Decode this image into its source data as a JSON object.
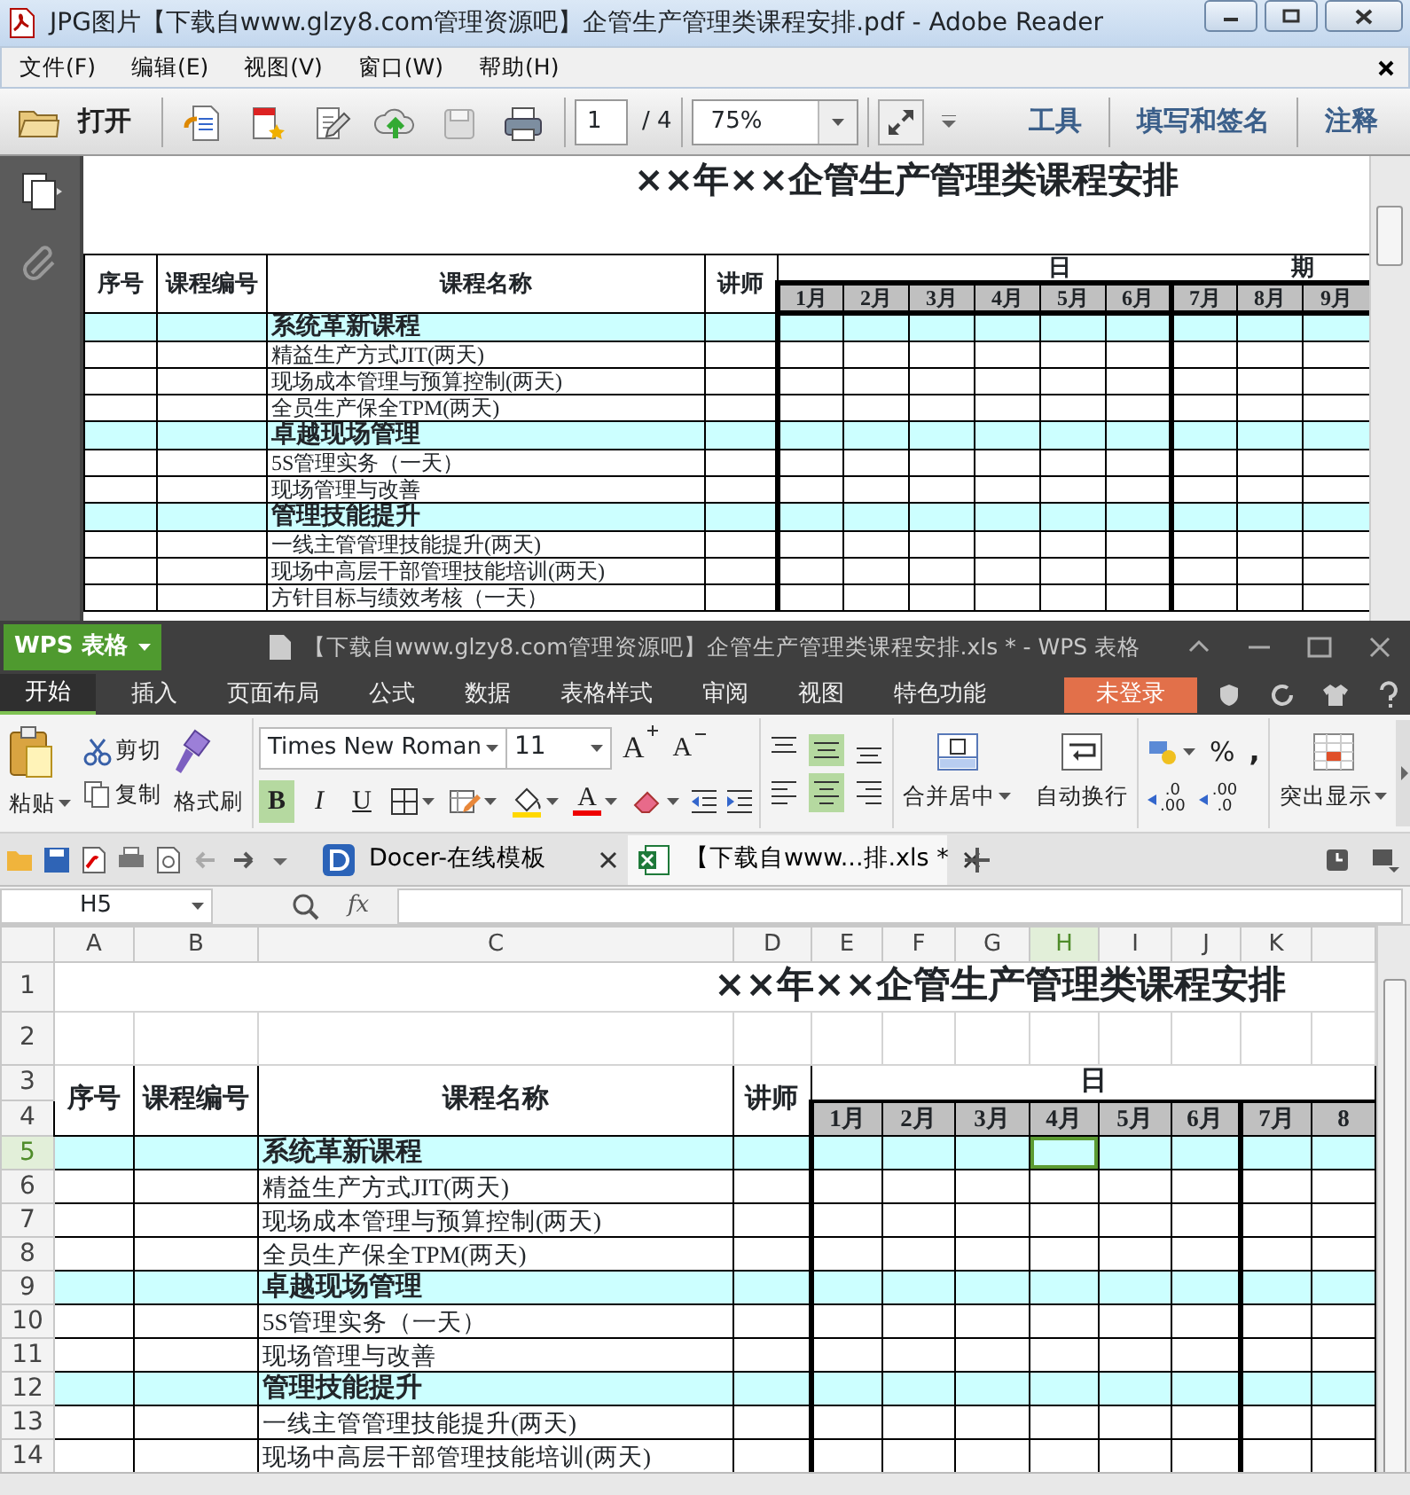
{
  "reader": {
    "title": "JPG图片【下载自www.glzy8.com管理资源吧】企管生产管理类课程安排.pdf - Adobe Reader",
    "menu": [
      "文件(F)",
      "编辑(E)",
      "视图(V)",
      "窗口(W)",
      "帮助(H)"
    ],
    "open_button": "打开",
    "page": "1",
    "page_total": "/ 4",
    "zoom": "75%",
    "panels": [
      "工具",
      "填写和签名",
      "注释"
    ],
    "document": {
      "title": "××年××企管生产管理类课程安排",
      "columns": [
        "序号",
        "课程编号",
        "课程名称",
        "讲师"
      ],
      "date_header": [
        "日",
        "期"
      ],
      "months": [
        "1月",
        "2月",
        "3月",
        "4月",
        "5月",
        "6月",
        "7月",
        "8月",
        "9月"
      ],
      "rows": [
        {
          "kind": "section",
          "name": "系统革新课程"
        },
        {
          "kind": "course",
          "name": "精益生产方式JIT(两天)"
        },
        {
          "kind": "course",
          "name": "现场成本管理与预算控制(两天)"
        },
        {
          "kind": "course",
          "name": "全员生产保全TPM(两天)"
        },
        {
          "kind": "section",
          "name": "卓越现场管理"
        },
        {
          "kind": "course",
          "name": "5S管理实务（一天）"
        },
        {
          "kind": "course",
          "name": "现场管理与改善"
        },
        {
          "kind": "section",
          "name": "管理技能提升"
        },
        {
          "kind": "course",
          "name": "一线主管管理技能提升(两天)"
        },
        {
          "kind": "course",
          "name": "现场中高层干部管理技能培训(两天)"
        },
        {
          "kind": "course",
          "name": "方针目标与绩效考核（一天）"
        }
      ]
    }
  },
  "wps": {
    "app_button": "WPS 表格",
    "title": "【下载自www.glzy8.com管理资源吧】企管生产管理类课程安排.xls * - WPS 表格",
    "tabs": [
      {
        "label": "开始",
        "selected": true
      },
      {
        "label": "插入",
        "selected": false
      },
      {
        "label": "页面布局",
        "selected": false
      },
      {
        "label": "公式",
        "selected": false
      },
      {
        "label": "数据",
        "selected": false
      },
      {
        "label": "表格样式",
        "selected": false
      },
      {
        "label": "审阅",
        "selected": false
      },
      {
        "label": "视图",
        "selected": false
      },
      {
        "label": "特色功能",
        "selected": false
      }
    ],
    "login": "未登录",
    "ribbon": {
      "paste": "粘贴",
      "cut": "剪切",
      "copy": "复制",
      "format_painter": "格式刷",
      "font": "Times New Roman",
      "size": "11",
      "grow_font": "A",
      "shrink_font": "A",
      "styles": [
        {
          "label": "B",
          "selected": true
        },
        {
          "label": "I",
          "selected": false
        },
        {
          "label": "U",
          "selected": false
        }
      ],
      "font_color": "A",
      "vertical_align": [
        {
          "kind": "top",
          "selected": false
        },
        {
          "kind": "middle",
          "selected": true
        },
        {
          "kind": "bottom",
          "selected": false
        }
      ],
      "horizontal_align": [
        {
          "kind": "left",
          "selected": false
        },
        {
          "kind": "center",
          "selected": true
        },
        {
          "kind": "right",
          "selected": false
        }
      ],
      "merge": "合并居中",
      "wrap": "自动换行",
      "percent": "%",
      "comma": ",",
      "decimals": [
        [
          ".0",
          ".00"
        ],
        [
          ".00",
          ".0"
        ]
      ],
      "highlight": "突出显示"
    },
    "doc_tabs": [
      {
        "label": "Docer-在线模板",
        "kind": "docer",
        "selected": false
      },
      {
        "label": "【下载自www...排.xls *",
        "kind": "sheet",
        "selected": true
      }
    ],
    "name_box": "H5",
    "fx": "fx",
    "sheet": {
      "columns": [
        {
          "label": "A",
          "selected": false
        },
        {
          "label": "B",
          "selected": false
        },
        {
          "label": "C",
          "selected": false
        },
        {
          "label": "D",
          "selected": false
        },
        {
          "label": "E",
          "selected": false
        },
        {
          "label": "F",
          "selected": false
        },
        {
          "label": "G",
          "selected": false
        },
        {
          "label": "H",
          "selected": true
        },
        {
          "label": "I",
          "selected": false
        },
        {
          "label": "J",
          "selected": false
        },
        {
          "label": "K",
          "selected": false
        }
      ],
      "title": "××年××企管生产管理类课程安排",
      "headers": [
        "序号",
        "课程编号",
        "课程名称",
        "讲师"
      ],
      "date_header": "日",
      "months": [
        "1月",
        "2月",
        "3月",
        "4月",
        "5月",
        "6月",
        "7月",
        "8"
      ],
      "top_rows": [
        "1",
        "2",
        "3",
        "4"
      ],
      "rows": [
        {
          "number": "5",
          "selected": true,
          "kind": "section",
          "name": "系统革新课程"
        },
        {
          "number": "6",
          "selected": false,
          "kind": "course",
          "name": "精益生产方式JIT(两天)"
        },
        {
          "number": "7",
          "selected": false,
          "kind": "course",
          "name": "现场成本管理与预算控制(两天)"
        },
        {
          "number": "8",
          "selected": false,
          "kind": "course",
          "name": "全员生产保全TPM(两天)"
        },
        {
          "number": "9",
          "selected": false,
          "kind": "section",
          "name": "卓越现场管理"
        },
        {
          "number": "10",
          "selected": false,
          "kind": "course",
          "name": "5S管理实务（一天）"
        },
        {
          "number": "11",
          "selected": false,
          "kind": "course",
          "name": "现场管理与改善"
        },
        {
          "number": "12",
          "selected": false,
          "kind": "section",
          "name": "管理技能提升"
        },
        {
          "number": "13",
          "selected": false,
          "kind": "course",
          "name": "一线主管管理技能提升(两天)"
        },
        {
          "number": "14",
          "selected": false,
          "kind": "course",
          "name": "现场中高层干部管理技能培训(两天)"
        }
      ]
    }
  }
}
